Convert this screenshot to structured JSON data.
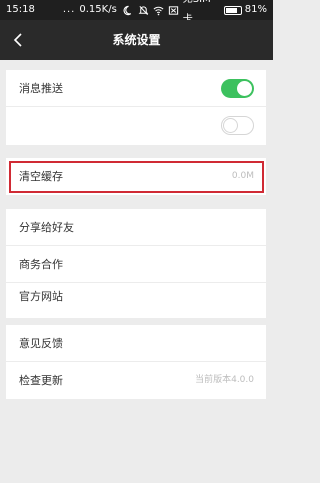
{
  "status_bar": {
    "time": "15:18",
    "dots": "...",
    "speed": "0.15K/s",
    "sim": "无SIM卡",
    "battery_percent": "81%",
    "battery_level": 0.81,
    "icons": [
      "moon-icon",
      "alarm-off-icon",
      "wifi-icon",
      "sim-card-icon",
      "battery-icon"
    ]
  },
  "title_bar": {
    "title": "系统设置",
    "back_icon": "chevron-left-icon"
  },
  "settings": {
    "push_notifications": {
      "label": "消息推送",
      "toggle_on": true
    },
    "second_toggle": {
      "label": "",
      "toggle_on": false
    },
    "clear_cache": {
      "label": "清空缓存",
      "value": "0.0M"
    },
    "share_friends": {
      "label": "分享给好友"
    },
    "business": {
      "label": "商务合作"
    },
    "official_site": {
      "label": "官方网站"
    },
    "feedback": {
      "label": "意见反馈"
    },
    "check_update": {
      "label": "检查更新",
      "value": "当前版本4.0.0"
    }
  },
  "colors": {
    "status_bar_bg": "#1f1f1f",
    "title_bar_bg": "#2a2a2a",
    "toggle_on": "#3cc15e",
    "highlight_border": "#d02a34",
    "page_bg": "#ececec"
  }
}
